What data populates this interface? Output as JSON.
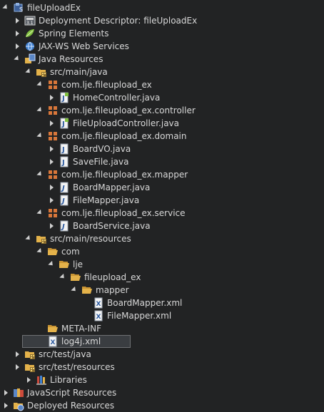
{
  "tree": [
    {
      "label": "fileUploadEx",
      "icon": "project-icon",
      "state": "open"
    },
    {
      "label": "Deployment Descriptor: fileUploadEx",
      "icon": "deployment-descriptor-icon",
      "state": "closed"
    },
    {
      "label": "Spring Elements",
      "icon": "spring-leaf-icon",
      "state": "closed"
    },
    {
      "label": "JAX-WS Web Services",
      "icon": "web-services-icon",
      "state": "closed"
    },
    {
      "label": "Java Resources",
      "icon": "java-resources-icon",
      "state": "open"
    },
    {
      "label": "src/main/java",
      "icon": "source-folder-icon",
      "state": "open"
    },
    {
      "label": "com.lje.fileupload_ex",
      "icon": "package-icon",
      "state": "open"
    },
    {
      "label": "HomeController.java",
      "icon": "spring-java-file-icon",
      "state": "closed"
    },
    {
      "label": "com.lje.fileupload_ex.controller",
      "icon": "package-icon",
      "state": "open"
    },
    {
      "label": "FileUploadController.java",
      "icon": "spring-java-file-icon",
      "state": "closed"
    },
    {
      "label": "com.lje.fileupload_ex.domain",
      "icon": "package-icon",
      "state": "open"
    },
    {
      "label": "BoardVO.java",
      "icon": "java-file-icon",
      "state": "closed"
    },
    {
      "label": "SaveFile.java",
      "icon": "java-file-icon",
      "state": "closed"
    },
    {
      "label": "com.lje.fileupload_ex.mapper",
      "icon": "package-icon",
      "state": "open"
    },
    {
      "label": "BoardMapper.java",
      "icon": "java-interface-file-icon",
      "state": "closed"
    },
    {
      "label": "FileMapper.java",
      "icon": "java-interface-file-icon",
      "state": "closed"
    },
    {
      "label": "com.lje.fileupload_ex.service",
      "icon": "package-icon",
      "state": "open"
    },
    {
      "label": "BoardService.java",
      "icon": "java-interface-file-icon",
      "state": "closed"
    },
    {
      "label": "src/main/resources",
      "icon": "source-folder-icon",
      "state": "open"
    },
    {
      "label": "com",
      "icon": "folder-open-icon",
      "state": "open"
    },
    {
      "label": "lje",
      "icon": "folder-open-icon",
      "state": "open"
    },
    {
      "label": "fileupload_ex",
      "icon": "folder-open-icon",
      "state": "open"
    },
    {
      "label": "mapper",
      "icon": "folder-open-icon",
      "state": "open"
    },
    {
      "label": "BoardMapper.xml",
      "icon": "xml-file-icon",
      "state": "none"
    },
    {
      "label": "FileMapper.xml",
      "icon": "xml-file-icon",
      "state": "none"
    },
    {
      "label": "META-INF",
      "icon": "folder-open-icon",
      "state": "none"
    },
    {
      "label": "log4j.xml",
      "icon": "xml-file-icon",
      "state": "none",
      "selected": true
    },
    {
      "label": "src/test/java",
      "icon": "source-folder-icon",
      "state": "closed"
    },
    {
      "label": "src/test/resources",
      "icon": "source-folder-icon",
      "state": "closed"
    },
    {
      "label": "Libraries",
      "icon": "libraries-icon",
      "state": "closed"
    },
    {
      "label": "JavaScript Resources",
      "icon": "javascript-resources-icon",
      "state": "closed"
    },
    {
      "label": "Deployed Resources",
      "icon": "deployed-resources-icon",
      "state": "closed"
    }
  ],
  "colors": {
    "background": "#222324",
    "text": "#d8d8d8",
    "selection": "#3a3d41",
    "package": "#d9773a",
    "folder": "#e4b24a",
    "spring": "#7fbf3f"
  }
}
